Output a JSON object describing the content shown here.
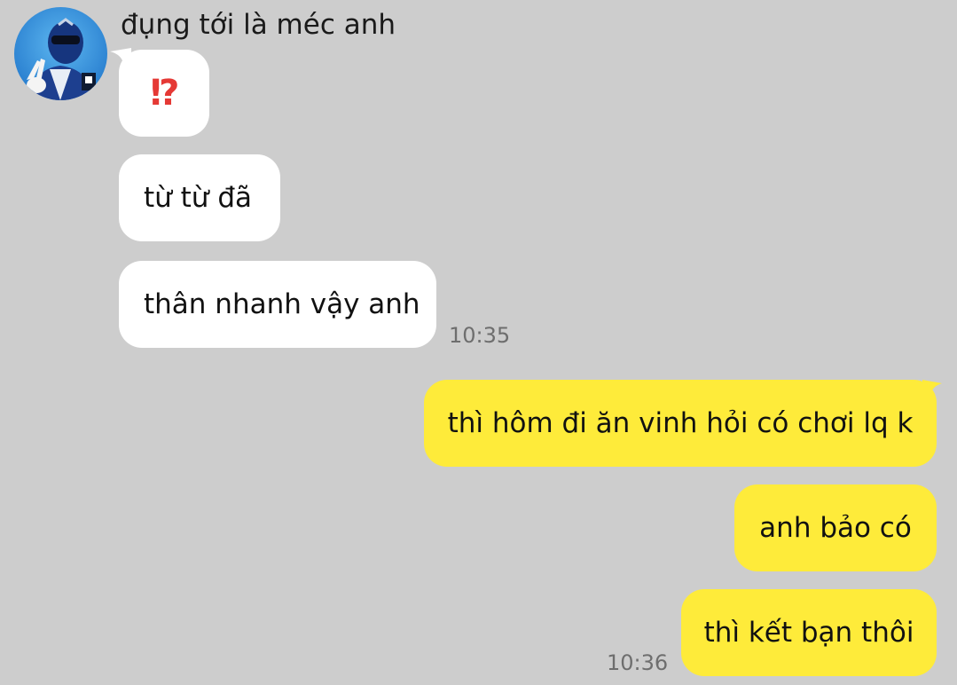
{
  "chat": {
    "incoming": {
      "sender_name": "đụng tới là méc anh",
      "avatar_icon": "sender-avatar",
      "messages": [
        {
          "text": "⁉",
          "emoji": "exclamation-question-mark-icon"
        },
        {
          "text": "từ từ đã"
        },
        {
          "text": "thân nhanh vậy anh"
        }
      ],
      "timestamp": "10:35"
    },
    "outgoing": {
      "messages": [
        {
          "text": "thì hôm đi ăn vinh hỏi có chơi lq k"
        },
        {
          "text": "anh bảo có"
        },
        {
          "text": "thì kết bạn thôi"
        }
      ],
      "timestamp": "10:36"
    }
  },
  "colors": {
    "background": "#cdcdcd",
    "incoming_bubble": "#ffffff",
    "outgoing_bubble": "#feeb3a",
    "timestamp": "#6e6e6e"
  }
}
